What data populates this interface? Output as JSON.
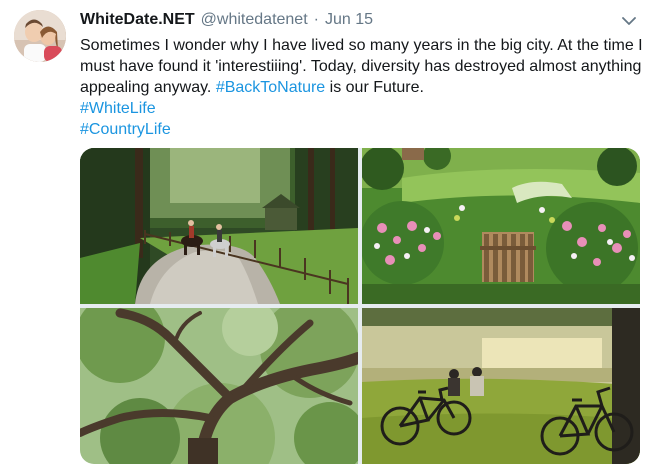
{
  "user": {
    "display_name": "WhiteDate.NET",
    "handle": "@whitedatenet",
    "separator": "·",
    "date": "Jun 15"
  },
  "tweet": {
    "text_main": "Sometimes I wonder why I have lived so many years in the big city. At the time I must have found it 'interestiiing'. Today, diversity has destroyed almost anything appealing anyway.",
    "hashtag_inline": "#BackToNature",
    "text_after": " is our Future.",
    "hashtag_1": "#WhiteLife",
    "hashtag_2": "#CountryLife"
  },
  "icons": {
    "avatar": "avatar-photo",
    "menu": "chevron-down-icon"
  },
  "media": {
    "photos": [
      "forest-road-horse-riders",
      "garden-flowers-gate",
      "oak-tree-branches",
      "lakeside-bicycles-couple"
    ]
  },
  "colors": {
    "link": "#1b95e0",
    "secondary_text": "#657786",
    "primary_text": "#14171a"
  }
}
